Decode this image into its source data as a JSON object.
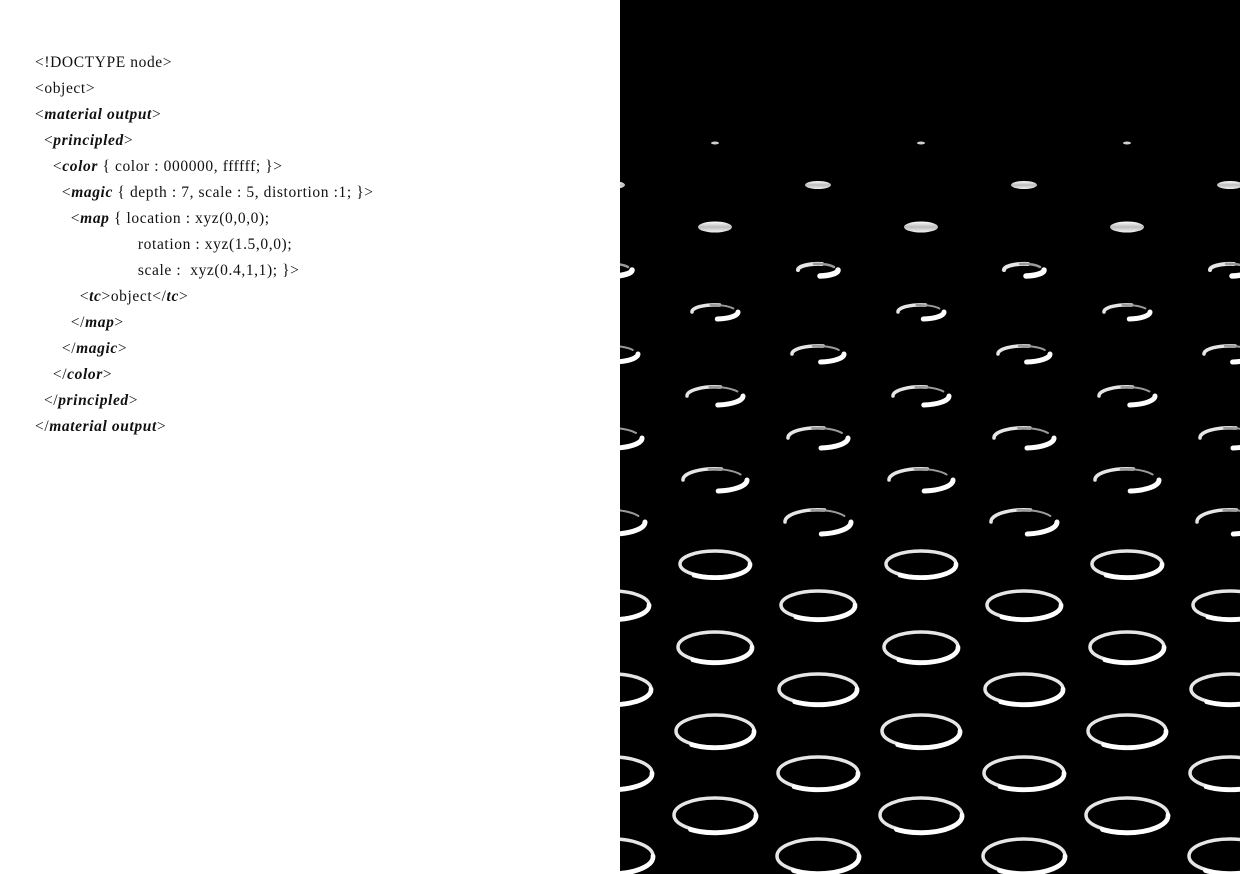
{
  "code_lines": [
    {
      "parts": [
        {
          "t": "<!DOCTYPE node>"
        }
      ]
    },
    {
      "parts": [
        {
          "t": "<object>"
        }
      ]
    },
    {
      "parts": [
        {
          "t": "<"
        },
        {
          "t": "material output",
          "i": true
        },
        {
          "t": ">"
        }
      ]
    },
    {
      "parts": [
        {
          "t": "  <"
        },
        {
          "t": "principled",
          "i": true
        },
        {
          "t": ">"
        }
      ]
    },
    {
      "parts": [
        {
          "t": "    <"
        },
        {
          "t": "color",
          "i": true
        },
        {
          "t": " { color : 000000, ffffff; }>"
        }
      ]
    },
    {
      "parts": [
        {
          "t": "      <"
        },
        {
          "t": "magic",
          "i": true
        },
        {
          "t": " { depth : 7, scale : 5, distortion :1; }>"
        }
      ]
    },
    {
      "parts": [
        {
          "t": "        <"
        },
        {
          "t": "map",
          "i": true
        },
        {
          "t": " { location : xyz(0,0,0);"
        }
      ]
    },
    {
      "parts": [
        {
          "t": "                       rotation : xyz(1.5,0,0);"
        }
      ]
    },
    {
      "parts": [
        {
          "t": "                       scale :  xyz(0.4,1,1); }>"
        }
      ]
    },
    {
      "parts": [
        {
          "t": "          <"
        },
        {
          "t": "tc",
          "i": true
        },
        {
          "t": ">object</"
        },
        {
          "t": "tc",
          "i": true
        },
        {
          "t": ">"
        }
      ]
    },
    {
      "parts": [
        {
          "t": "        </"
        },
        {
          "t": "map",
          "i": true
        },
        {
          "t": ">"
        }
      ]
    },
    {
      "parts": [
        {
          "t": "      </"
        },
        {
          "t": "magic",
          "i": true
        },
        {
          "t": ">"
        }
      ]
    },
    {
      "parts": [
        {
          "t": "    </"
        },
        {
          "t": "color",
          "i": true
        },
        {
          "t": ">"
        }
      ]
    },
    {
      "parts": [
        {
          "t": "  </"
        },
        {
          "t": "principled",
          "i": true
        },
        {
          "t": ">"
        }
      ]
    },
    {
      "parts": [
        {
          "t": "</"
        },
        {
          "t": "material output",
          "i": true
        },
        {
          "t": ">"
        }
      ]
    }
  ],
  "render": {
    "background": "#000000",
    "ring_color": "#e6e6e6"
  }
}
